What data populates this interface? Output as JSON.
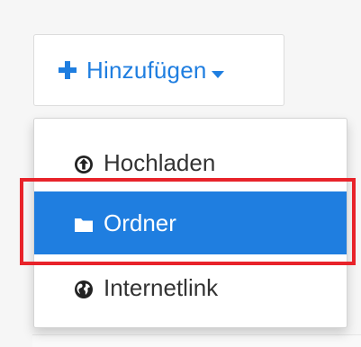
{
  "add_button": {
    "label": "Hinzufügen",
    "icon": "plus-icon",
    "caret_icon": "caret-down-icon",
    "color": "#1f7ee0"
  },
  "menu": {
    "items": [
      {
        "label": "Hochladen",
        "icon": "upload-circle-icon",
        "active": false
      },
      {
        "label": "Ordner",
        "icon": "folder-icon",
        "active": true
      },
      {
        "label": "Internetlink",
        "icon": "globe-icon",
        "active": false
      }
    ],
    "active_color": "#1f7ee0",
    "highlight_color": "#e8232a"
  }
}
